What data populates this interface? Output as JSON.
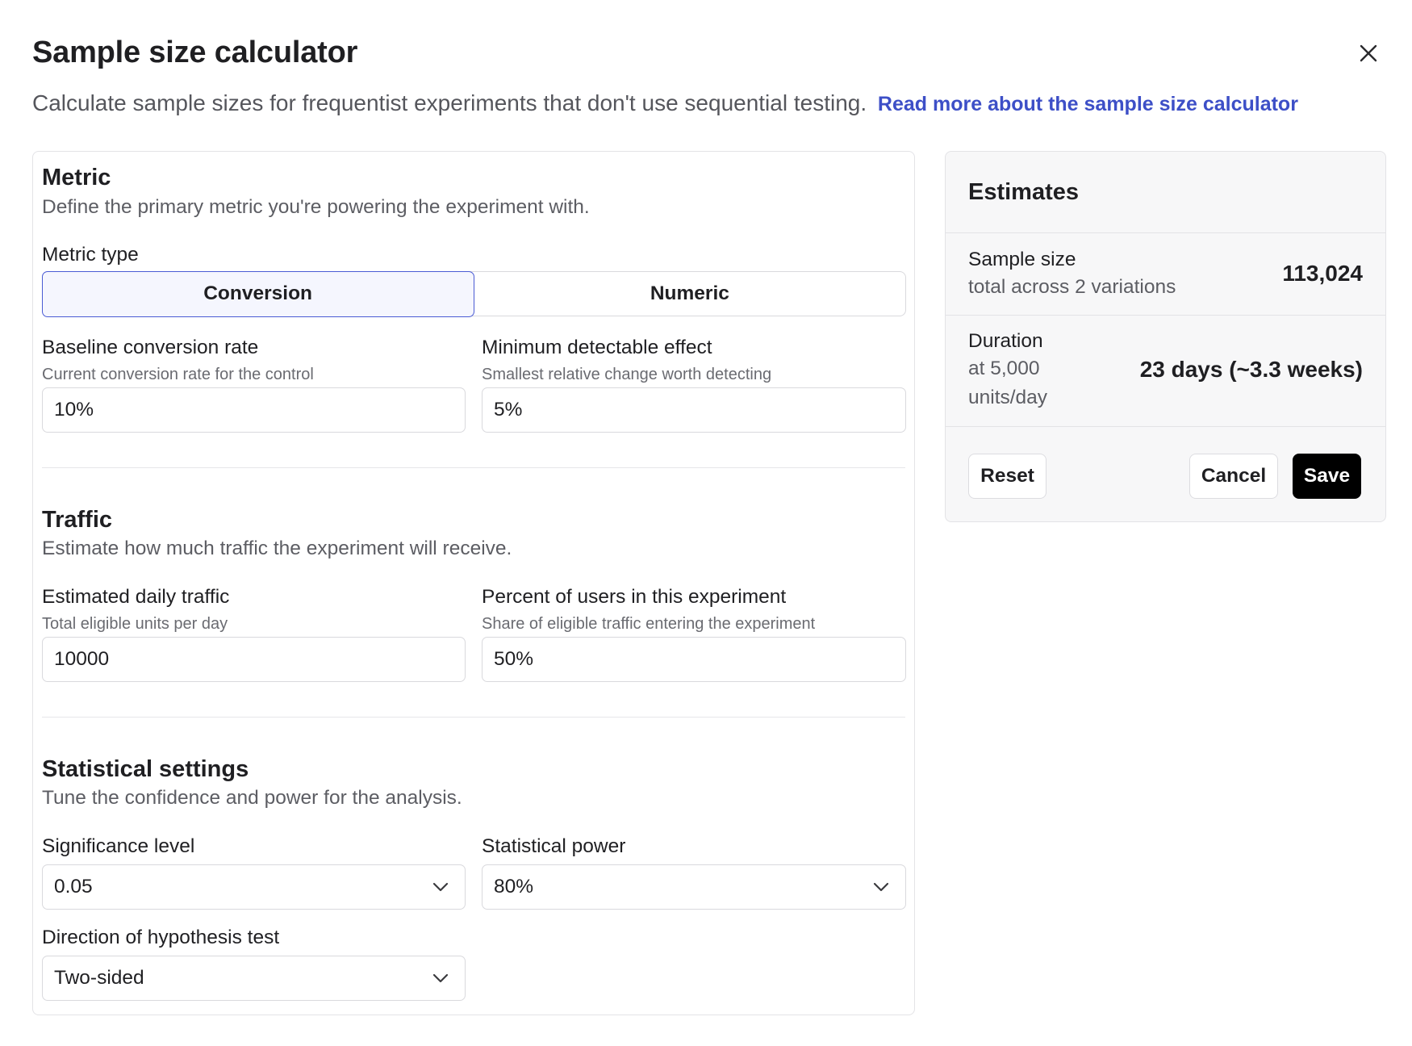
{
  "header": {
    "title": "Sample size calculator",
    "subtitle": "Calculate sample sizes for frequentist experiments that don't use sequential testing.",
    "link_text": "Read more about the sample size calculator",
    "close_icon": "close-icon"
  },
  "metric": {
    "title": "Metric",
    "description": "Define the primary metric you're powering the experiment with.",
    "type_label": "Metric type",
    "options": [
      "Conversion",
      "Numeric"
    ],
    "selected": "Conversion",
    "baseline": {
      "label": "Baseline conversion rate",
      "hint": "Current conversion rate for the control",
      "value": "10%"
    },
    "mde": {
      "label": "Minimum detectable effect",
      "hint": "Smallest relative change worth detecting",
      "value": "5%"
    }
  },
  "traffic": {
    "title": "Traffic",
    "description": "Estimate how much traffic the experiment will receive.",
    "daily": {
      "label": "Estimated daily traffic",
      "hint": "Total eligible units per day",
      "value": "10000"
    },
    "percent": {
      "label": "Percent of users in this experiment",
      "hint": "Share of eligible traffic entering the experiment",
      "value": "50%"
    }
  },
  "stats": {
    "title": "Statistical settings",
    "description": "Tune the confidence and power for the analysis.",
    "significance": {
      "label": "Significance level",
      "value": "0.05"
    },
    "power": {
      "label": "Statistical power",
      "value": "80%"
    },
    "direction": {
      "label": "Direction of hypothesis test",
      "value": "Two-sided"
    }
  },
  "estimates": {
    "title": "Estimates",
    "sample_size": {
      "label": "Sample size",
      "sub": "total across 2 variations",
      "value": "113,024"
    },
    "duration": {
      "label": "Duration",
      "sub_line1": "at 5,000",
      "sub_line2": "units/day",
      "value": "23 days (~3.3 weeks)"
    },
    "reset_label": "Reset",
    "cancel_label": "Cancel",
    "save_label": "Save"
  },
  "colors": {
    "accent": "#4a5bd4",
    "link": "#3d4fc7",
    "primary_button": "#000000",
    "panel_bg": "#f7f7f8"
  }
}
